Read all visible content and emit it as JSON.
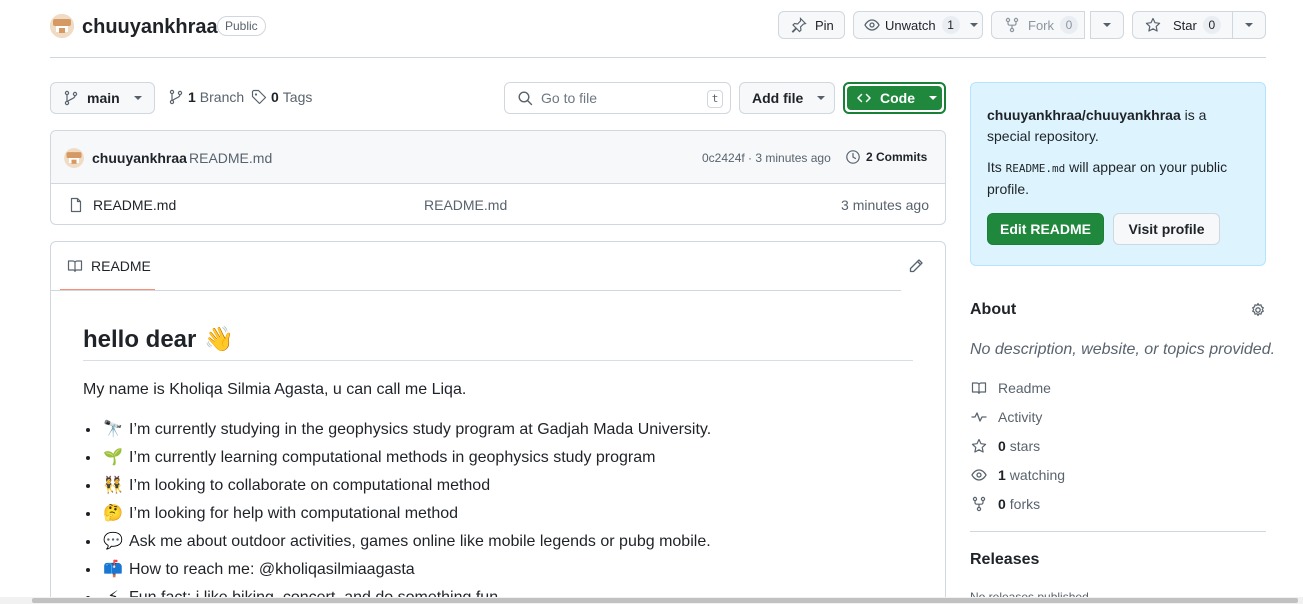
{
  "repo": {
    "name": "chuuyankhraa",
    "visibility": "Public"
  },
  "header_actions": {
    "pin_label": "Pin",
    "unwatch_label": "Unwatch",
    "watch_count": "1",
    "fork_label": "Fork",
    "fork_count": "0",
    "star_label": "Star",
    "star_count": "0"
  },
  "toolbar": {
    "branch": "main",
    "branch_count": "1",
    "branch_label": "Branch",
    "tag_count": "0",
    "tag_label": "Tags",
    "search_placeholder": "Go to file",
    "search_shortcut": "t",
    "add_file_label": "Add file",
    "code_label": "Code"
  },
  "commit_bar": {
    "author": "chuuyankhraa",
    "message": "README.md",
    "hash_time": "0c2424f · 3 minutes ago",
    "commits_label": "2 Commits"
  },
  "files": [
    {
      "name": "README.md",
      "message": "README.md",
      "time": "3 minutes ago"
    }
  ],
  "readme": {
    "tab_label": "README",
    "heading": "hello dear",
    "heading_emoji": "👋",
    "intro": "My name is Kholiqa Silmia Agasta, u can call me Liqa.",
    "items": [
      {
        "emoji": "🔭",
        "text": "I’m currently studying in the geophysics study program at Gadjah Mada University."
      },
      {
        "emoji": "🌱",
        "text": "I’m currently learning computational methods in geophysics study program"
      },
      {
        "emoji": "👯",
        "text": "I’m looking to collaborate on computational method"
      },
      {
        "emoji": "🤔",
        "text": "I’m looking for help with computational method"
      },
      {
        "emoji": "💬",
        "text": "Ask me about outdoor activities, games online like mobile legends or pubg mobile."
      },
      {
        "emoji": "📫",
        "text": "How to reach me: @kholiqasilmiaagasta"
      },
      {
        "emoji": "⚡",
        "text": "Fun fact: i like biking, concert, and do something fun"
      }
    ]
  },
  "special_box": {
    "repo_path": "chuuyankhraa/chuuyankhraa",
    "is_special": " is a special repository.",
    "its": "Its ",
    "file_code": "README.md",
    "will_appear": " will appear on your public profile.",
    "edit_label": "Edit README",
    "visit_label": "Visit profile"
  },
  "about": {
    "title": "About",
    "description": "No description, website, or topics provided.",
    "readme_label": "Readme",
    "activity_label": "Activity",
    "stars_count": "0",
    "stars_label": "stars",
    "watching_count": "1",
    "watching_label": "watching",
    "forks_count": "0",
    "forks_label": "forks"
  },
  "releases": {
    "title": "Releases",
    "empty": "No releases published"
  },
  "colors": {
    "accent_green": "#1f883d",
    "tab_underline": "#fd8c73",
    "special_bg": "#ddf4ff"
  }
}
